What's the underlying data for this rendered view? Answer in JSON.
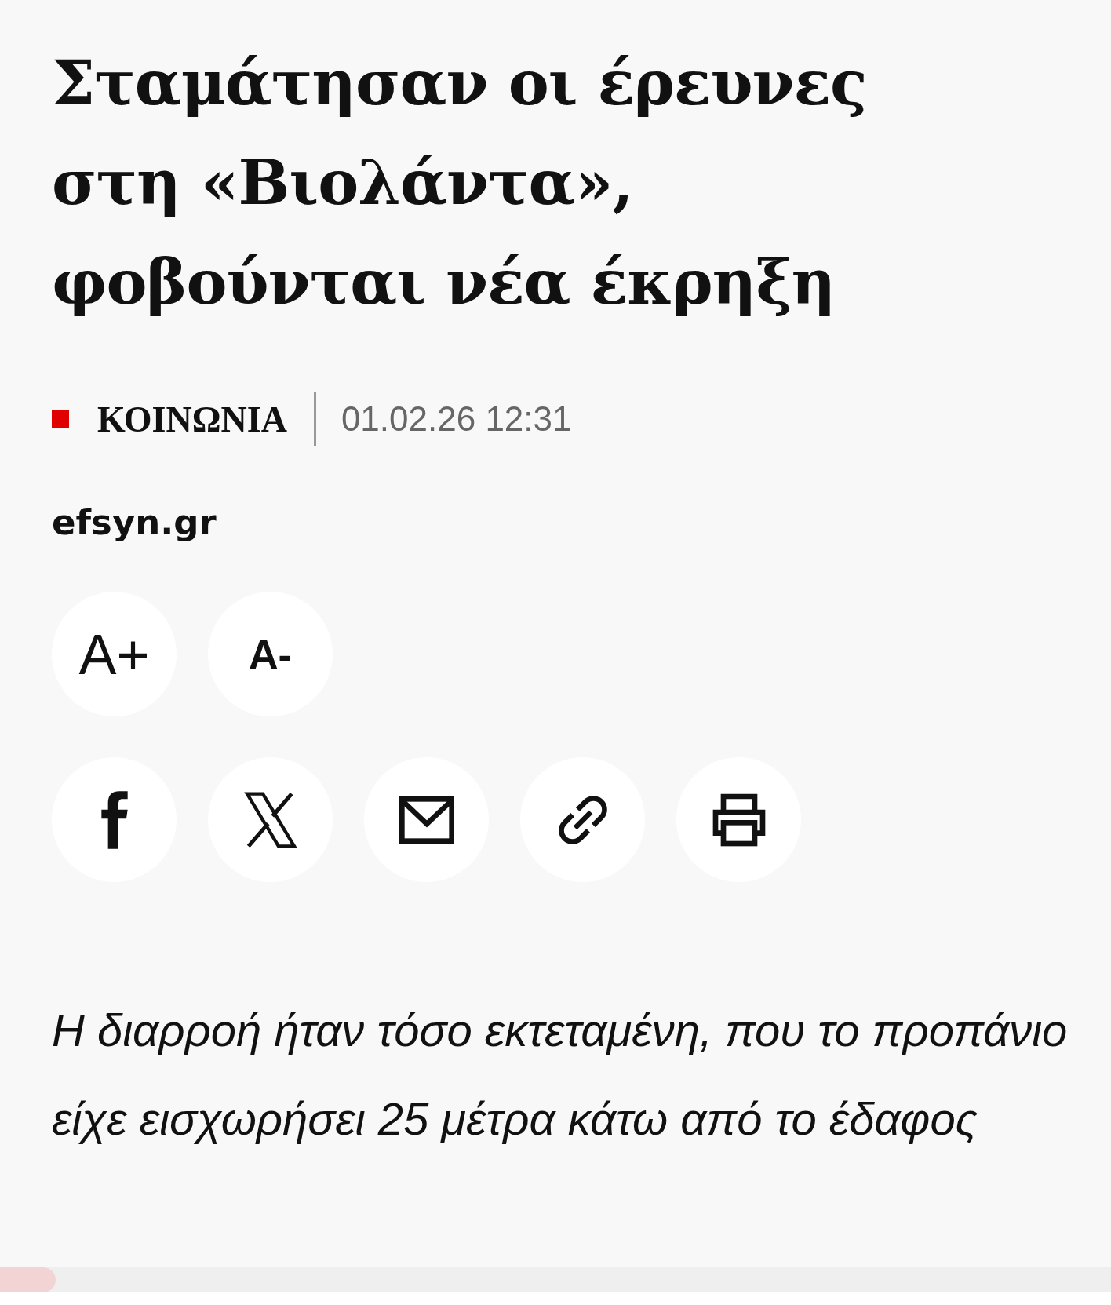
{
  "title": "Σταμάτησαν οι έρευνες στη «Βιολάντα», φοβούνται νέα έκρηξη",
  "meta": {
    "category": "ΚΟΙΝΩΝΙΑ",
    "date": "01.02.26 12:31"
  },
  "source": "efsyn.gr",
  "font_buttons": [
    {
      "kind": "increase",
      "label": "A+"
    },
    {
      "kind": "decrease",
      "label": "A-"
    }
  ],
  "share_buttons": [
    {
      "kind": "facebook"
    },
    {
      "kind": "x"
    },
    {
      "kind": "email"
    },
    {
      "kind": "link"
    },
    {
      "kind": "print"
    }
  ],
  "lead": "Η διαρροή ήταν τόσο εκτεταμένη, που το προπάνιο είχε εισχωρήσει 25 μέτρα κάτω από το έδαφος",
  "reading_progress": {
    "level": 0.05
  }
}
